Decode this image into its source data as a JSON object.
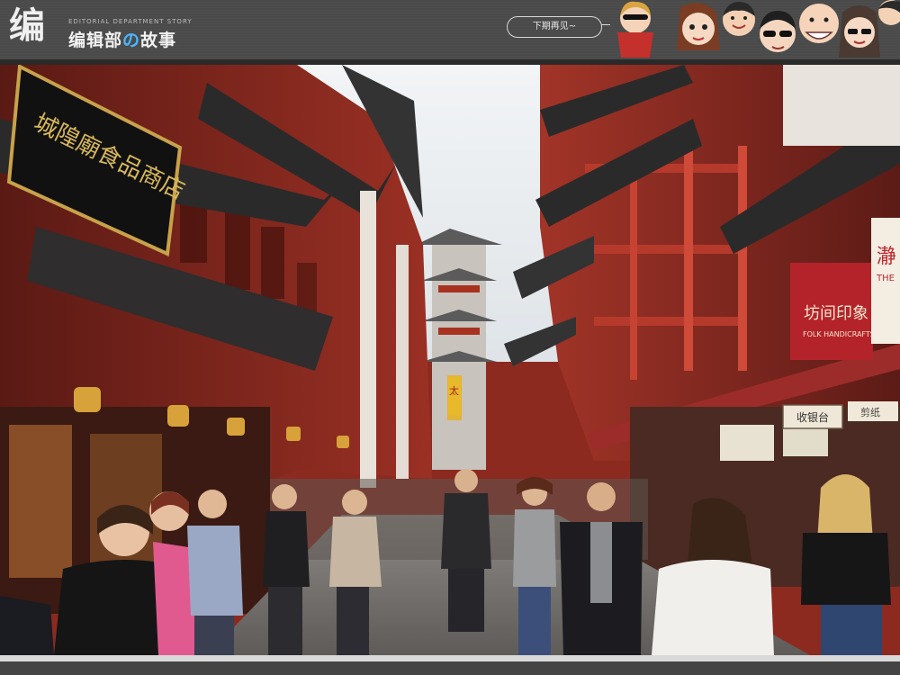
{
  "header": {
    "logo_mark": "编",
    "brand_en": "EDITORIAL DEPARTMENT STORY",
    "brand_cn_1": "编辑部",
    "brand_cn_2": "の",
    "brand_cn_3": "故事",
    "bubble_text": "下期再见~"
  },
  "photo": {
    "left_sign": "城隍廟食品商店",
    "right_sign_cn": "坊间印象",
    "right_sign_en": "FOLK HANDICRAFTS",
    "right_sign_red": "瀞",
    "right_sign_red_en": "THE",
    "small_sign_1": "收银台",
    "small_sign_2": "剪纸",
    "banner": "太"
  },
  "colors": {
    "header_bg": "#4a4a4a",
    "wood_red": "#8c2a1f",
    "roof_dark": "#2b2a2a",
    "sky": "#e9eef2",
    "accent_blue": "#4db6ff"
  }
}
